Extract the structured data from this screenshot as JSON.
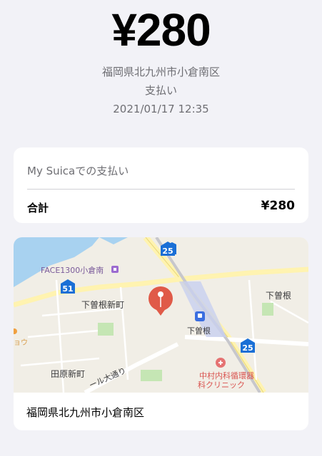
{
  "header": {
    "amount": "¥280",
    "location": "福岡県北九州市小倉南区",
    "description": "支払い",
    "datetime": "2021/01/17 12:35"
  },
  "payment_card": {
    "title": "My Suicaでの支払い",
    "total_label": "合計",
    "total_value": "¥280"
  },
  "map_card": {
    "map": {
      "labels": {
        "face": "FACE1300小倉南",
        "shimosone_shinmachi": "下曽根新町",
        "shimosone_station": "下曽根",
        "shimosone": "下曽根",
        "tahara_shinmachi": "田原新町",
        "road": "ール大通り",
        "clinic_line1": "中村内科循環器",
        "clinic_line2": "科クリニック",
        "partial": "ョウ"
      },
      "route_badges": {
        "r25_top": "25",
        "r51": "51",
        "r25_bottom": "25"
      }
    },
    "address": "福岡県北九州市小倉南区"
  }
}
